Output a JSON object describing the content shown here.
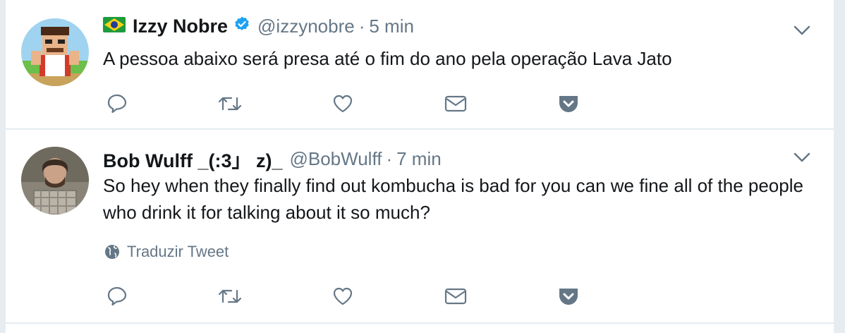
{
  "colors": {
    "text_primary": "#14171a",
    "text_secondary": "#657786",
    "icon": "#657786",
    "verified_blue": "#1da1f2",
    "divider": "#e6ecf0"
  },
  "tweets": [
    {
      "flag_icon": "brazil-flag-icon",
      "name": "Izzy Nobre",
      "verified": true,
      "handle": "@izzynobre",
      "separator": "·",
      "time": "5 min",
      "text": "A pessoa abaixo será presa até o fim do ano pela operação Lava Jato",
      "actions": [
        "reply-icon",
        "retweet-icon",
        "like-icon",
        "direct-message-icon",
        "pocket-icon"
      ]
    },
    {
      "name": "Bob Wulff _(:3」 z)_",
      "verified": false,
      "handle": "@BobWulff",
      "separator": "·",
      "time": "7 min",
      "text": "So hey when they finally find out kombucha is bad for you can we fine all of the people who drink it for talking about it so much?",
      "translate_label": "Traduzir Tweet",
      "actions": [
        "reply-icon",
        "retweet-icon",
        "like-icon",
        "direct-message-icon",
        "pocket-icon"
      ]
    }
  ]
}
